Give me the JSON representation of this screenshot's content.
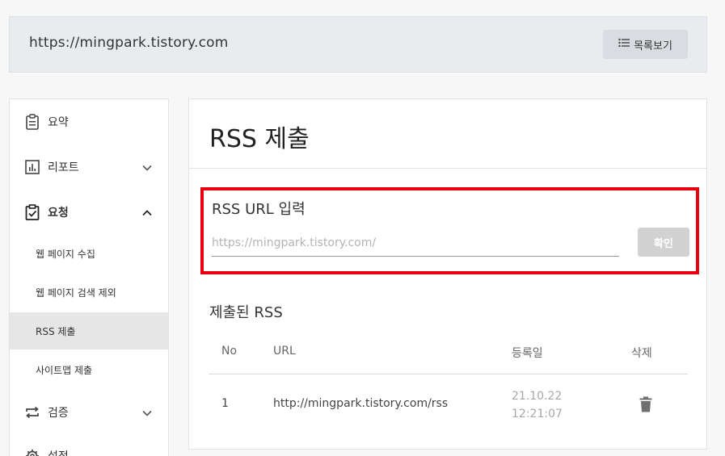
{
  "header": {
    "site_url": "https://mingpark.tistory.com",
    "list_button_label": "목록보기"
  },
  "sidebar": {
    "items": [
      {
        "label": "요약",
        "icon": "clipboard-icon"
      },
      {
        "label": "리포트",
        "icon": "bar-chart-icon",
        "expand": "chevron-down-icon"
      },
      {
        "label": "요청",
        "icon": "clipboard-check-icon",
        "expand": "chevron-up-icon"
      },
      {
        "label": "검증",
        "icon": "repeat-icon",
        "expand": "chevron-down-icon"
      },
      {
        "label": "설정",
        "icon": "gear-icon"
      }
    ],
    "sub_items": [
      {
        "label": "웹 페이지 수집"
      },
      {
        "label": "웹 페이지 검색 제외"
      },
      {
        "label": "RSS 제출",
        "active": true
      },
      {
        "label": "사이트맵 제출"
      }
    ]
  },
  "main": {
    "title": "RSS 제출",
    "rss_form": {
      "label": "RSS URL 입력",
      "placeholder": "https://mingpark.tistory.com/",
      "value": "",
      "confirm_label": "확인"
    },
    "submitted": {
      "title": "제출된 RSS",
      "columns": [
        "No",
        "URL",
        "등록일",
        "삭제"
      ],
      "rows": [
        {
          "no": "1",
          "url": "http://mingpark.tistory.com/rss",
          "date": "21.10.22 12:21:07",
          "delete_icon": "trash-icon"
        }
      ]
    }
  },
  "colors": {
    "highlight_border": "#e8000d",
    "active_sidebar_bg": "#e6e6e6",
    "disabled_button": "#d2d2d2"
  }
}
